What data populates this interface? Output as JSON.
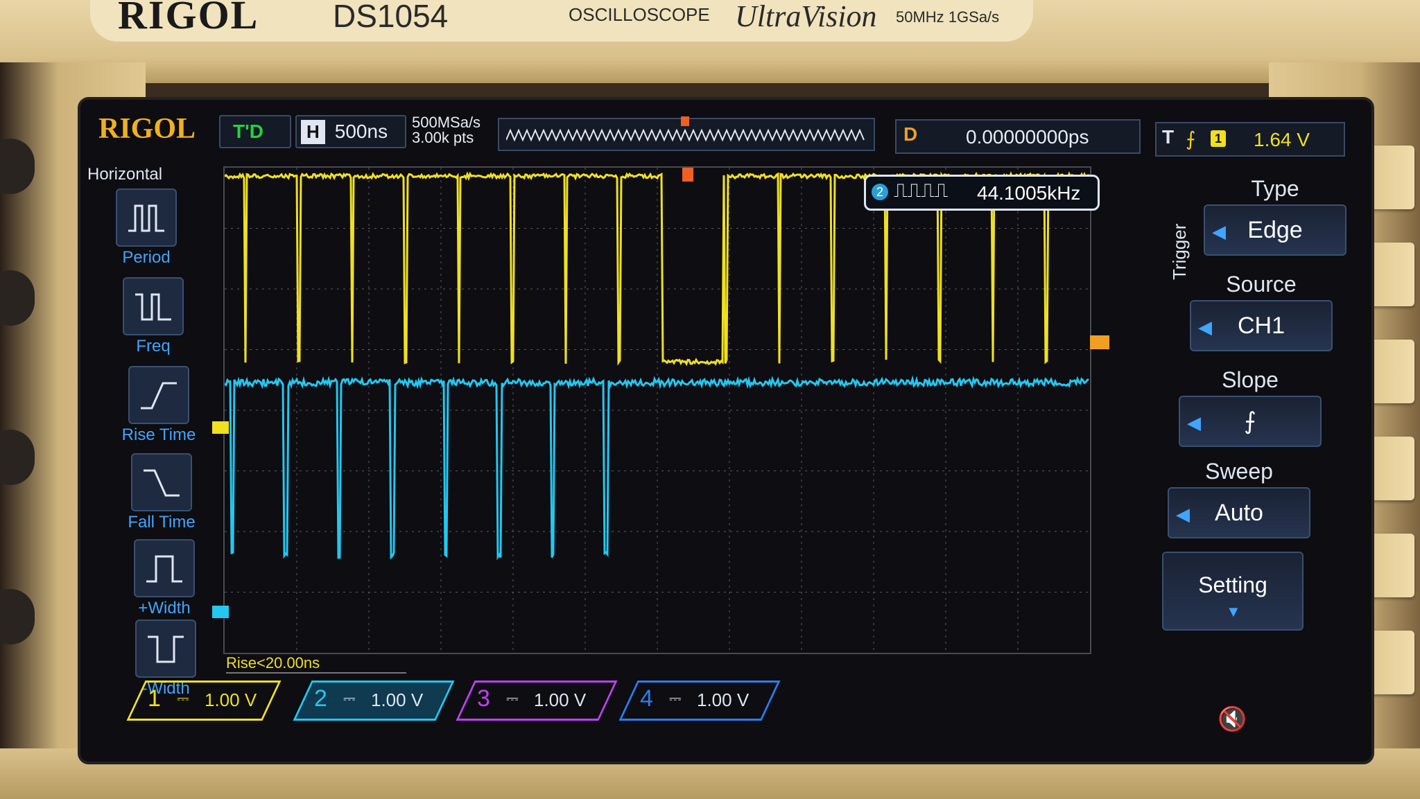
{
  "device": {
    "brand": "RIGOL",
    "model": "DS1054",
    "type": "OSCILLOSCOPE",
    "series": "UltraVision",
    "spec": "50MHz 1GSa/s"
  },
  "topbar": {
    "logo": "RIGOL",
    "run_state": "T'D",
    "horizontal_label": "H",
    "timebase": "500ns",
    "sample_rate": "500MSa/s",
    "memory_depth": "3.00k pts",
    "delay_label": "D",
    "delay_value": "0.00000000ps",
    "trigger_label": "T",
    "trigger_slope_symbol": "⨍",
    "trigger_channel": "1",
    "trigger_level": "1.64 V"
  },
  "left_menu": {
    "title": "Horizontal",
    "items": [
      {
        "label": "Period",
        "icon": "period-icon"
      },
      {
        "label": "Freq",
        "icon": "freq-icon"
      },
      {
        "label": "Rise Time",
        "icon": "rise-time-icon"
      },
      {
        "label": "Fall Time",
        "icon": "fall-time-icon"
      },
      {
        "label": "+Width",
        "icon": "positive-width-icon"
      },
      {
        "label": "-Width",
        "icon": "negative-width-icon"
      }
    ]
  },
  "measurement": {
    "channel": "2",
    "symbol": "⎍⎍⎍⎍",
    "frequency": "44.1005kHz",
    "rise": "Rise<20.00ns"
  },
  "channels": [
    {
      "num": "1",
      "coupling": "⎓",
      "scale": "1.00 V",
      "color": "#f0e020"
    },
    {
      "num": "2",
      "coupling": "⎓",
      "scale": "1.00 V",
      "color": "#22c8f0"
    },
    {
      "num": "3",
      "coupling": "⎓",
      "scale": "1.00 V",
      "color": "#c040f0"
    },
    {
      "num": "4",
      "coupling": "⎓",
      "scale": "1.00 V",
      "color": "#2a7ef0"
    }
  ],
  "trigger_menu": {
    "title": "Trigger",
    "type_label": "Type",
    "type_value": "Edge",
    "source_label": "Source",
    "source_value": "CH1",
    "slope_label": "Slope",
    "slope_value": "⨍",
    "sweep_label": "Sweep",
    "sweep_value": "Auto",
    "setting_label": "Setting"
  },
  "colors": {
    "ch1": "#f0e020",
    "ch2": "#22c8f0",
    "ch3": "#c040f0",
    "ch4": "#2a7ef0",
    "accent": "#f0a020"
  }
}
